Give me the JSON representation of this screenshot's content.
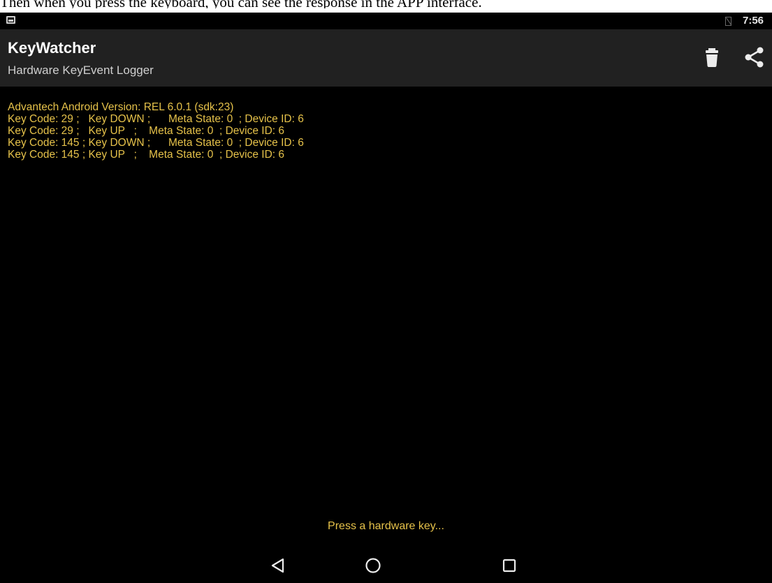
{
  "caption": "Then when you press the keyboard, you can see the response in the APP interface.",
  "status_bar": {
    "time": "7:56",
    "icons": [
      "image-notification-icon",
      "no-sim-icon"
    ]
  },
  "app_bar": {
    "title": "KeyWatcher",
    "subtitle": "Hardware KeyEvent Logger",
    "actions": [
      {
        "name": "delete",
        "icon": "trash-icon"
      },
      {
        "name": "share",
        "icon": "share-icon"
      }
    ]
  },
  "log": {
    "lines": [
      "Advantech Android Version: REL 6.0.1 (sdk:23)",
      "Key Code: 29 ;   Key DOWN ;      Meta State: 0  ; Device ID: 6",
      "Key Code: 29 ;   Key UP   ;    Meta State: 0  ; Device ID: 6",
      "Key Code: 145 ; Key DOWN ;      Meta State: 0  ; Device ID: 6",
      "Key Code: 145 ; Key UP   ;    Meta State: 0  ; Device ID: 6"
    ]
  },
  "hint": "Press a hardware key...",
  "nav_bar": {
    "buttons": [
      "back-icon",
      "home-icon",
      "recents-icon"
    ]
  },
  "colors": {
    "log_text": "#e6c24a",
    "app_bar_bg": "#212121",
    "screen_bg": "#000000"
  }
}
